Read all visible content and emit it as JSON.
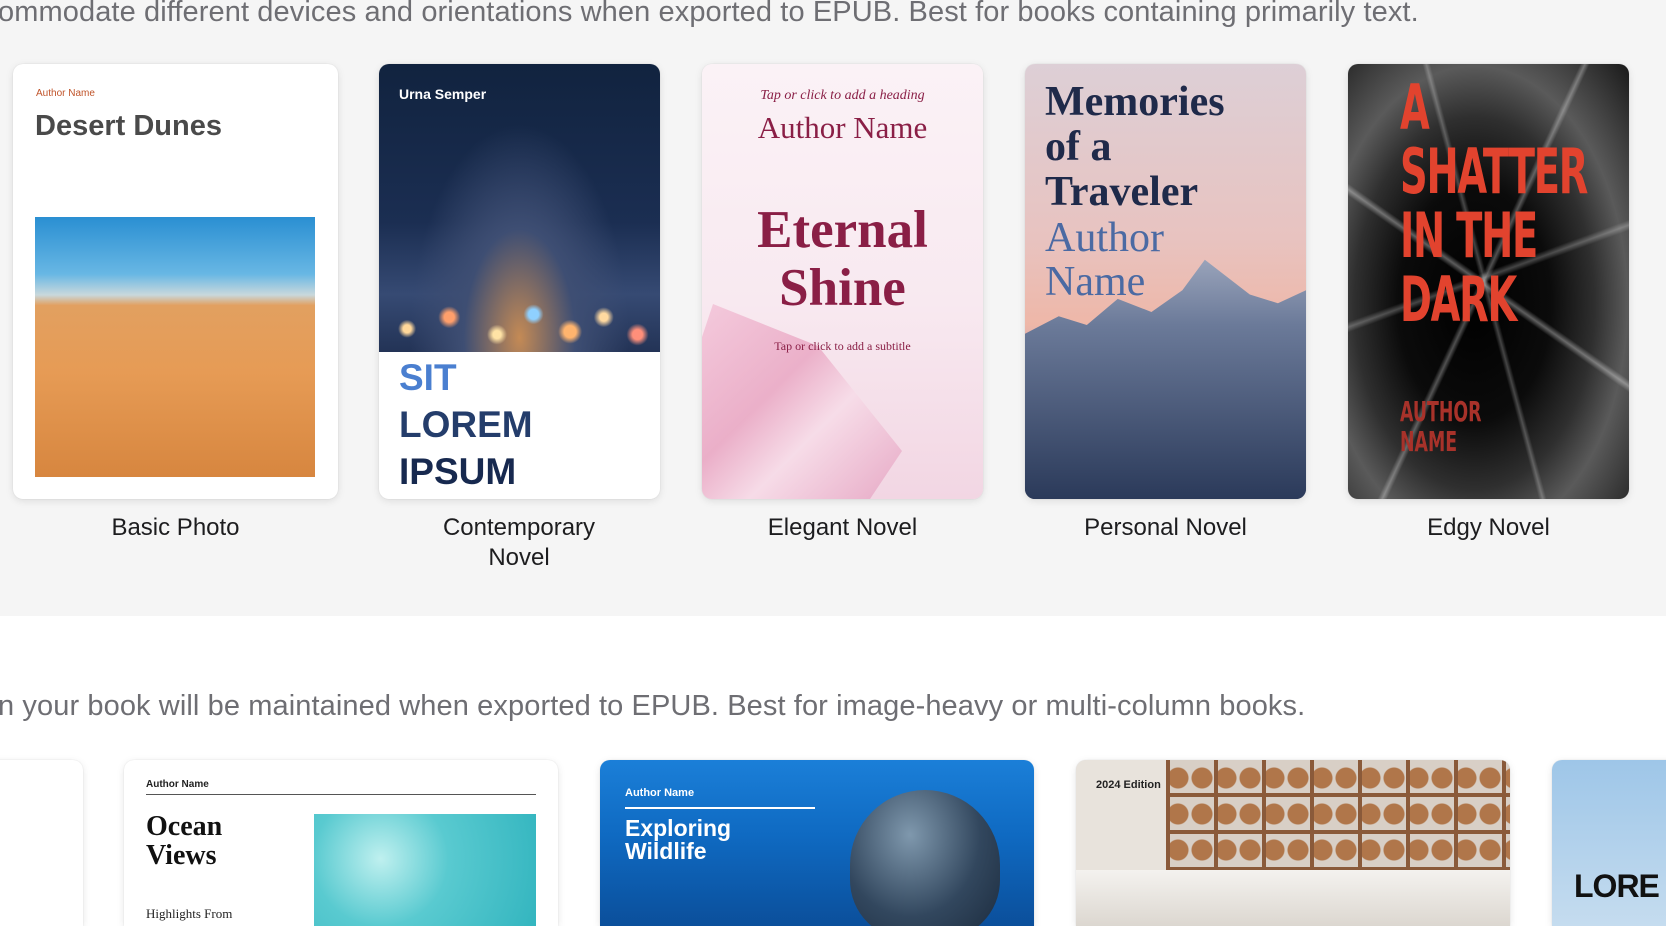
{
  "descriptions": {
    "reflowable": "ommodate different devices and orientations when exported to EPUB. Best for books containing primarily text.",
    "fixed": "n your book will be maintained when exported to EPUB. Best for image-heavy or multi-column books."
  },
  "templates_row1": [
    {
      "caption": "Basic Photo",
      "cover": {
        "author": "Author Name",
        "title": "Desert Dunes"
      }
    },
    {
      "caption": "Contemporary Novel",
      "cover": {
        "author": "Urna Semper",
        "line1": "SIT",
        "line2": "LOREM",
        "line3": "IPSUM"
      }
    },
    {
      "caption": "Elegant Novel",
      "cover": {
        "heading": "Tap or click to add a heading",
        "author": "Author Name",
        "title": "Eternal Shine",
        "subtitle": "Tap or click to add a subtitle"
      }
    },
    {
      "caption": "Personal Novel",
      "cover": {
        "title": "Memories of a Traveler",
        "author": "Author Name"
      }
    },
    {
      "caption": "Edgy Novel",
      "cover": {
        "title": "A SHATTER IN THE DARK",
        "author": "AUTHOR NAME"
      }
    }
  ],
  "templates_row2": [
    {
      "cover": {}
    },
    {
      "cover": {
        "author": "Author Name",
        "title": "Ocean Views",
        "subtitle": "Highlights From"
      }
    },
    {
      "cover": {
        "author": "Author Name",
        "title": "Exploring Wildlife"
      }
    },
    {
      "cover": {
        "edition": "2024 Edition"
      }
    },
    {
      "cover": {
        "title": "LORE"
      }
    }
  ]
}
